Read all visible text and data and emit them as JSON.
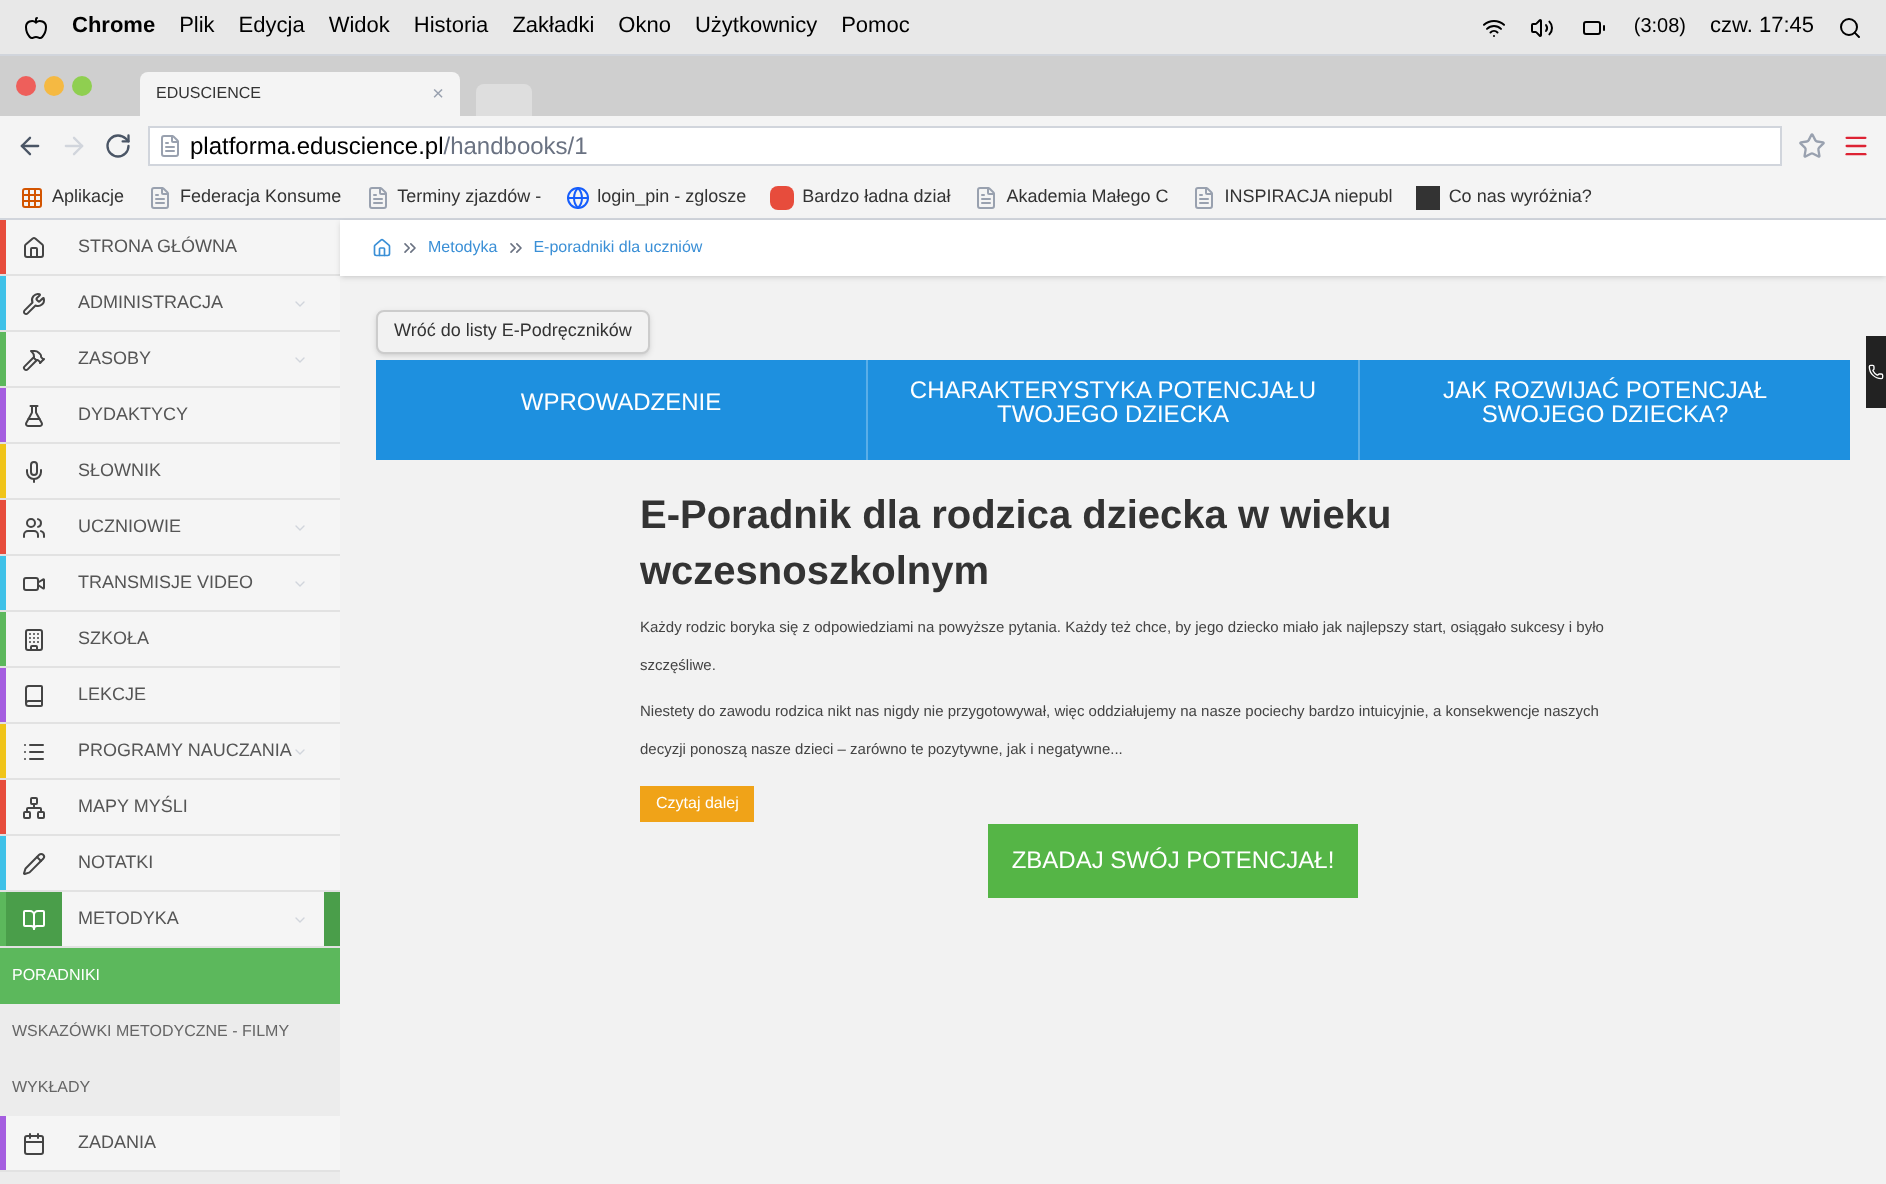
{
  "menu_bar": {
    "app": "Chrome",
    "items": [
      "Plik",
      "Edycja",
      "Widok",
      "Historia",
      "Zakładki",
      "Okno",
      "Użytkownicy",
      "Pomoc"
    ],
    "battery": "(3:08)",
    "clock": "czw. 17:45"
  },
  "tab": {
    "title": "EDUSCIENCE",
    "close": "×"
  },
  "address_bar": {
    "host": "platforma.eduscience.pl",
    "path": "/handbooks/1"
  },
  "bookmarks": [
    {
      "kind": "apps",
      "label": "Aplikacje"
    },
    {
      "kind": "page",
      "label": "Federacja Konsume"
    },
    {
      "kind": "page",
      "label": "Terminy zjazdów -"
    },
    {
      "kind": "globe",
      "label": "login_pin - zglosze"
    },
    {
      "kind": "red",
      "label": "Bardzo ładna dział"
    },
    {
      "kind": "page",
      "label": "Akademia Małego C"
    },
    {
      "kind": "page",
      "label": "INSPIRACJA niepubl"
    },
    {
      "kind": "m",
      "label": "Co nas wyróżnia?"
    }
  ],
  "sidebar": {
    "items": [
      {
        "label": "STRONA GŁÓWNA",
        "color": "#e74c3c",
        "submenu": false,
        "selected": false
      },
      {
        "label": "ADMINISTRACJA",
        "color": "#3fc1e8",
        "submenu": true,
        "selected": false
      },
      {
        "label": "ZASOBY",
        "color": "#5cb85c",
        "submenu": true,
        "selected": false
      },
      {
        "label": "DYDAKTYCY",
        "color": "#a55ee0",
        "submenu": false,
        "selected": false
      },
      {
        "label": "SŁOWNIK",
        "color": "#f0c419",
        "submenu": false,
        "selected": false
      },
      {
        "label": "UCZNIOWIE",
        "color": "#e74c3c",
        "submenu": true,
        "selected": false
      },
      {
        "label": "TRANSMISJE VIDEO",
        "color": "#3fc1e8",
        "submenu": true,
        "selected": false
      },
      {
        "label": "SZKOŁA",
        "color": "#5cb85c",
        "submenu": false,
        "selected": false
      },
      {
        "label": "LEKCJE",
        "color": "#a55ee0",
        "submenu": false,
        "selected": false
      },
      {
        "label": "PROGRAMY NAUCZANIA",
        "color": "#f0c419",
        "submenu": true,
        "selected": false
      },
      {
        "label": "MAPY MYŚLI",
        "color": "#e74c3c",
        "submenu": false,
        "selected": false
      },
      {
        "label": "NOTATKI",
        "color": "#3fc1e8",
        "submenu": false,
        "selected": false
      },
      {
        "label": "METODYKA",
        "color": "#5cb85c",
        "submenu": true,
        "selected": true,
        "children": [
          {
            "label": "PORADNIKI",
            "selected": true
          },
          {
            "label": "WSKAZÓWKI METODYCZNE - FILMY",
            "selected": false
          },
          {
            "label": "WYKŁADY",
            "selected": false
          }
        ]
      },
      {
        "label": "ZADANIA",
        "color": "#a55ee0",
        "submenu": false,
        "selected": false
      }
    ]
  },
  "breadcrumb": [
    "Metodyka",
    "E-poradniki dla uczniów"
  ],
  "back_button": "Wróć do listy E-Podręczników",
  "section_tabs": [
    "WPROWADZENIE",
    "CHARAKTERYSTYKA POTENCJAŁU TWOJEGO DZIECKA",
    "JAK ROZWIJAĆ POTENCJAŁ SWOJEGO DZIECKA?"
  ],
  "article": {
    "title": "E-Poradnik dla rodzica dziecka w wieku wczesnoszkolnym",
    "paragraphs": [
      "Każdy rodzic boryka się z odpowiedziami na powyższe pytania. Każdy też chce, by jego dziecko miało jak najlepszy start, osiągało sukcesy i było szczęśliwe.",
      "Niestety do zawodu rodzica nikt nas nigdy nie przygotowywał, więc oddziałujemy na nasze pociechy bardzo intuicyjnie, a konsekwencje naszych decyzji ponoszą nasze dzieci – zarówno te pozytywne, jak i negatywne..."
    ],
    "read_more": "Czytaj dalej",
    "cta": "ZBADAJ SWÓJ POTENCJAŁ!"
  }
}
